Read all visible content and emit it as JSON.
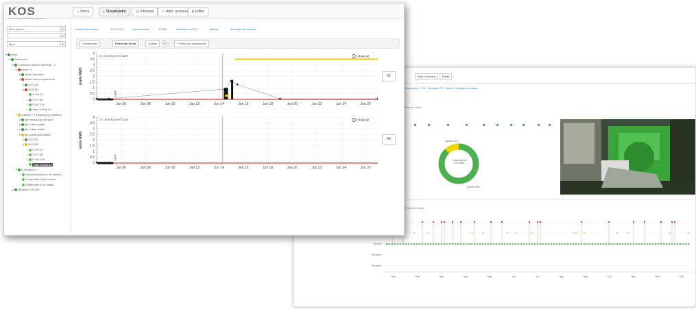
{
  "app": {
    "logo": "KOS",
    "logo_sub": "Knowledge Operation System"
  },
  "nav": [
    {
      "label": "Home",
      "icon": "home-icon",
      "glyph": "⌂"
    },
    {
      "label": "Visualizador",
      "icon": "search-icon",
      "glyph": "⌕"
    },
    {
      "label": "Informes",
      "icon": "report-icon",
      "glyph": "▤"
    },
    {
      "label": "Adm. acciones",
      "icon": "wrench-icon",
      "glyph": "✎"
    },
    {
      "label": "Editor",
      "icon": "editor-icon",
      "glyph": "▮"
    }
  ],
  "sidebar": {
    "select1": "Ebro Alumín",
    "select2": "",
    "select3": "Mina",
    "tree": [
      {
        "label": "Mina",
        "color": "#3a9a3a",
        "indent": 0,
        "prefix": "▾ "
      },
      {
        "label": "Extracción",
        "color": "#3a9a3a",
        "indent": 1,
        "prefix": "▾ "
      },
      {
        "label": "Extracción (Rapid Opening) - 1",
        "color": "#3a9a3a",
        "indent": 2,
        "prefix": "▾ "
      },
      {
        "label": "Motor 11",
        "color": "#d33",
        "indent": 3,
        "prefix": "▾ "
      },
      {
        "label": "Motor lado libre",
        "color": "#3a9a3a",
        "indent": 4,
        "prefix": "▸ "
      },
      {
        "label": "Motor lado acoplamiento",
        "color": "#d33",
        "indent": 4,
        "prefix": "▾ "
      },
      {
        "label": "ACO-M1",
        "color": "#3a9a3a",
        "indent": 5,
        "prefix": "▸ "
      },
      {
        "label": "ACO-M1",
        "color": "#d33",
        "indent": 5,
        "prefix": "▾ "
      },
      {
        "label": "E-H3-V1",
        "color": "#6b6",
        "indent": 6,
        "prefix": "✓ "
      },
      {
        "label": "E-P1-M1",
        "color": "#6b6",
        "indent": 6,
        "prefix": "✓ "
      },
      {
        "label": "E-M1-190",
        "color": "#6b6",
        "indent": 6,
        "prefix": "✓ "
      },
      {
        "label": "Valor Global A1",
        "color": "#6b6",
        "indent": 6,
        "prefix": "✓ "
      },
      {
        "label": "Cilindro + 1 Etapas (por paralelo)",
        "color": "#e6c000",
        "indent": 3,
        "prefix": "▾ "
      },
      {
        "label": "eje entrada lado al apio",
        "color": "#3a9a3a",
        "indent": 4,
        "prefix": "▸ "
      },
      {
        "label": "eje 2 lado salida",
        "color": "#3a9a3a",
        "indent": 4,
        "prefix": "▸ "
      },
      {
        "label": "eje 3 lado salida",
        "color": "#3a9a3a",
        "indent": 4,
        "prefix": "▸ "
      },
      {
        "label": "eje salida lado salida",
        "color": "#e6c000",
        "indent": 4,
        "prefix": "▾ "
      },
      {
        "label": "ACO-M1",
        "color": "#3a9a3a",
        "indent": 5,
        "prefix": "▸ "
      },
      {
        "label": "ACO-M1",
        "color": "#e6c000",
        "indent": 5,
        "prefix": "▾ "
      },
      {
        "label": "E-H3-V1",
        "color": "#6b6",
        "indent": 6,
        "prefix": "✓ "
      },
      {
        "label": "E-P1-M1",
        "color": "#6b6",
        "indent": 6,
        "prefix": "✓ "
      },
      {
        "label": "E-M1-190",
        "color": "#6b6",
        "indent": 6,
        "prefix": "✓ "
      },
      {
        "label": "Valor Global A1",
        "color": "#6b6",
        "indent": 6,
        "prefix": "✓ ",
        "highlight": true
      },
      {
        "label": "Lubricación 1",
        "color": "#3a9a3a",
        "indent": 3,
        "prefix": "▾ "
      },
      {
        "label": "Velocidad (rpm lpl 2in sensor)",
        "color": "#6b6",
        "indent": 4,
        "prefix": "✓ "
      },
      {
        "label": "Temperatura Eje entrada",
        "color": "#6b6",
        "indent": 4,
        "prefix": "✓ "
      },
      {
        "label": "Temperatura Eje salida",
        "color": "#6b6",
        "indent": 4,
        "prefix": "✓ "
      },
      {
        "label": "Máquina 130-180",
        "color": "#3a9a3a",
        "indent": 2,
        "prefix": "▸ "
      }
    ]
  },
  "tabs": [
    "Cambio de estados",
    "RTD-DCS",
    "Componentes",
    "FLMSI",
    "Mensajes de RTS",
    "Alertas",
    "Mensajes de equipos"
  ],
  "filters": {
    "conditions": "Condiciones",
    "by_date": "Filtrar por fecha",
    "count": "3 datos",
    "add": "+ Filtrar por condiciones"
  },
  "charts": [
    {
      "button": "H1",
      "credit": "JS chart by amCharts",
      "show_all": "Show all",
      "marker": "13/05"
    },
    {
      "button": "H2",
      "credit": "JS chart by amCharts",
      "show_all": "Show all",
      "marker": "13/05"
    }
  ],
  "chart_data": [
    {
      "type": "line",
      "ylabel": "mm/s RMS",
      "ylim": [
        0,
        4.0
      ],
      "yticks": [
        0.0,
        0.5,
        1.0,
        1.5,
        2.0,
        2.5,
        3.0,
        3.5,
        4.0
      ],
      "xticks": [
        "Jun 06",
        "Jun 08",
        "Jun 10",
        "Jun 12",
        "Jun 14",
        "Jun 16",
        "Jun 18",
        "Jun 20",
        "Jun 22",
        "Jun 24",
        "Jun 26"
      ],
      "threshold_lines": [
        0.0,
        3.5
      ],
      "x": [
        "Jun 04",
        "Jun 05",
        "Jun 14.5",
        "Jun 15",
        "Jun 15.5",
        "Jun 19",
        "Jun 27"
      ],
      "values": [
        0.05,
        0.05,
        0.9,
        1.6,
        1.3,
        0.05,
        0.05
      ]
    },
    {
      "type": "line",
      "ylabel": "mm/s RMS",
      "ylim": [
        0,
        4.0
      ],
      "yticks": [
        0.0,
        0.5,
        1.0,
        1.5,
        2.0,
        2.5,
        3.0,
        3.5,
        4.0
      ],
      "xticks": [
        "Jun 06",
        "Jun 08",
        "Jun 10",
        "Jun 12",
        "Jun 14",
        "Jun 16",
        "Jun 18",
        "Jun 20",
        "Jun 22",
        "Jun 24",
        "Jun 26"
      ],
      "threshold_lines": [
        0.0
      ],
      "x": [
        "Jun 04",
        "Jun 05"
      ],
      "values": [
        0.05,
        0.05
      ]
    }
  ],
  "back_window": {
    "nav": [
      "Adm. acciones",
      "Editor"
    ],
    "tabs": "Componentes · RTD · Mensajes RTS · Alertas · Mensajes de equipos",
    "filter_label": "Filtrar por estado",
    "ring_label": "Estado global",
    "ring_sub": "Sin datos",
    "ring_caption_a": "Ajustes 12%",
    "ring_caption_b": "Estado 88%",
    "ring_green": 0.88,
    "ring_yellow": 0.12,
    "timeline_ylabels": [
      "Alarma",
      "Alerta",
      "Normal",
      "Sin datos",
      "Sin datos"
    ],
    "timeline_xlabels": [
      "Ene",
      "Feb",
      "Mar",
      "Abr",
      "May",
      "Jun",
      "Jul",
      "Ago",
      "Sep",
      "Oct",
      "Nov",
      "2019",
      "Feb"
    ]
  },
  "colors": {
    "green": "#4caf50",
    "yellow": "#f2d600",
    "red": "#e53935",
    "link": "#2a7fbf"
  }
}
